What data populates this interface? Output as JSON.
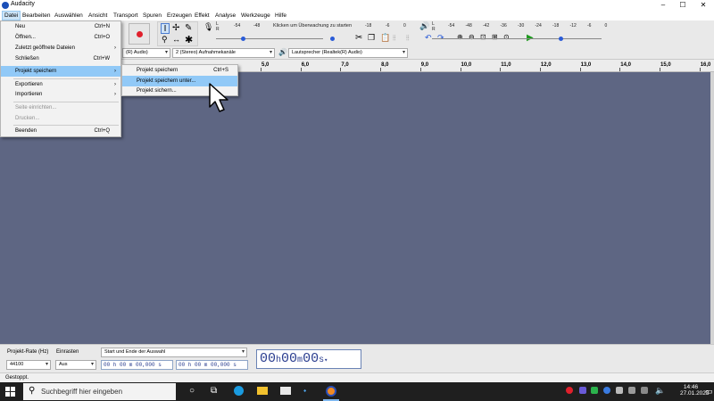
{
  "window": {
    "title": "Audacity"
  },
  "menubar": [
    "Datei",
    "Bearbeiten",
    "Auswählen",
    "Ansicht",
    "Transport",
    "Spuren",
    "Erzeugen",
    "Effekt",
    "Analyse",
    "Werkzeuge",
    "Hilfe"
  ],
  "file_menu": {
    "items": [
      {
        "label": "Neu",
        "shortcut": "Ctrl+N"
      },
      {
        "label": "Öffnen...",
        "shortcut": "Ctrl+O"
      },
      {
        "label": "Zuletzt geöffnete Dateien",
        "shortcut": ""
      },
      {
        "label": "Schließen",
        "shortcut": "Ctrl+W"
      },
      {
        "label": "Projekt speichern",
        "shortcut": ""
      },
      {
        "label": "Exportieren",
        "shortcut": ""
      },
      {
        "label": "Importieren",
        "shortcut": ""
      },
      {
        "label": "Seite einrichten...",
        "shortcut": ""
      },
      {
        "label": "Drucken...",
        "shortcut": ""
      },
      {
        "label": "Beenden",
        "shortcut": "Ctrl+Q"
      }
    ]
  },
  "save_submenu": {
    "items": [
      {
        "label": "Projekt speichern",
        "shortcut": "Ctrl+S"
      },
      {
        "label": "Projekt speichern unter...",
        "shortcut": ""
      },
      {
        "label": "Projekt sichern...",
        "shortcut": ""
      }
    ]
  },
  "meters": {
    "record_label": "R",
    "left_label": "L",
    "record_scale": [
      "-54",
      "-48",
      "Klicken um Überwachung zu starten",
      "-18",
      "-6",
      "0"
    ],
    "playback_scale": [
      "-54",
      "-48",
      "-42",
      "-36",
      "-30",
      "-24",
      "-18",
      "-12",
      "-6",
      "0"
    ]
  },
  "devices": {
    "input_device": "(R) Audio)",
    "channels": "2 (Stereo) Aufnahmekanäle",
    "output_device": "Lautsprecher (Realtek(R) Audio)"
  },
  "ruler": {
    "ticks": [
      "5,0",
      "6,0",
      "7,0",
      "8,0",
      "9,0",
      "10,0",
      "11,0",
      "12,0",
      "13,0",
      "14,0",
      "15,0",
      "16,0"
    ]
  },
  "bottom": {
    "rate_label": "Projekt-Rate (Hz)",
    "rate_value": "44100",
    "snap_label": "Einrasten",
    "snap_value": "Aus",
    "selection_label": "Start und Ende der Auswahl",
    "sel_start": "00 h 00 m 00,000 s",
    "sel_end": "00 h 00 m 00,000 s",
    "time_h": "00",
    "time_m": "00",
    "time_s": "00"
  },
  "status": {
    "text": "Gestoppt."
  },
  "taskbar": {
    "search_placeholder": "Suchbegriff hier eingeben",
    "time": "14:46",
    "date": "27.01.2023"
  },
  "colors": {
    "track_bg": "#5e6683",
    "highlight": "#91c9f7",
    "record": "#e0202c",
    "play": "#1e9a1e"
  }
}
